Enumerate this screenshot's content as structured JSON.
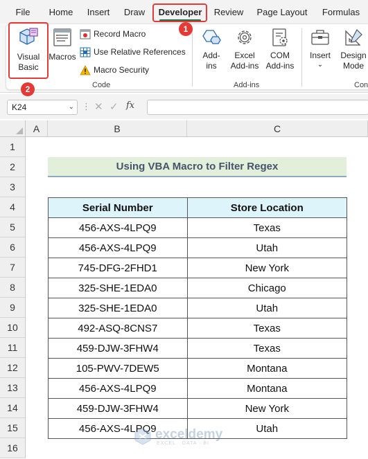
{
  "ribbon_tabs": [
    {
      "label": "File"
    },
    {
      "label": "Home"
    },
    {
      "label": "Insert"
    },
    {
      "label": "Draw"
    },
    {
      "label": "Developer",
      "active": true
    },
    {
      "label": "Review"
    },
    {
      "label": "Page Layout"
    },
    {
      "label": "Formulas"
    }
  ],
  "annotations": {
    "step1": "1",
    "step2": "2",
    "highlight_color": "#e23b3b"
  },
  "ribbon": {
    "code_group": {
      "label": "Code",
      "visual_basic": {
        "line1": "Visual",
        "line2": "Basic"
      },
      "macros": "Macros",
      "record_macro": "Record Macro",
      "relative_refs": "Use Relative References",
      "macro_security": "Macro Security"
    },
    "addins_group": {
      "label": "Add-ins",
      "addins": {
        "line1": "Add-",
        "line2": "ins"
      },
      "excel_addins": {
        "line1": "Excel",
        "line2": "Add-ins"
      },
      "com_addins": {
        "line1": "COM",
        "line2": "Add-ins"
      }
    },
    "controls_group": {
      "label": "Con",
      "insert": "Insert",
      "design_mode": {
        "line1": "Design",
        "line2": "Mode"
      }
    }
  },
  "formula_bar": {
    "name_box": "K24",
    "fx": "fx",
    "formula": ""
  },
  "columns": [
    "A",
    "B",
    "C"
  ],
  "rows": [
    "1",
    "2",
    "3",
    "4",
    "5",
    "6",
    "7",
    "8",
    "9",
    "10",
    "11",
    "12",
    "13",
    "14",
    "15",
    "16"
  ],
  "sheet": {
    "title": "Using VBA Macro to Filter Regex",
    "headers": {
      "serial": "Serial Number",
      "location": "Store Location"
    },
    "records": [
      {
        "serial": "456-AXS-4LPQ9",
        "location": "Texas"
      },
      {
        "serial": "456-AXS-4LPQ9",
        "location": "Utah"
      },
      {
        "serial": "745-DFG-2FHD1",
        "location": "New York"
      },
      {
        "serial": "325-SHE-1EDA0",
        "location": "Chicago"
      },
      {
        "serial": "325-SHE-1EDA0",
        "location": "Utah"
      },
      {
        "serial": "492-ASQ-8CNS7",
        "location": "Texas"
      },
      {
        "serial": "459-DJW-3FHW4",
        "location": "Texas"
      },
      {
        "serial": "105-PWV-7DEW5",
        "location": "Montana"
      },
      {
        "serial": "456-AXS-4LPQ9",
        "location": "Montana"
      },
      {
        "serial": "459-DJW-3FHW4",
        "location": "New York"
      },
      {
        "serial": "456-AXS-4LPQ9",
        "location": "Utah"
      }
    ]
  },
  "watermark": {
    "name": "exceldemy",
    "tagline": "EXCEL · DATA · BI"
  }
}
